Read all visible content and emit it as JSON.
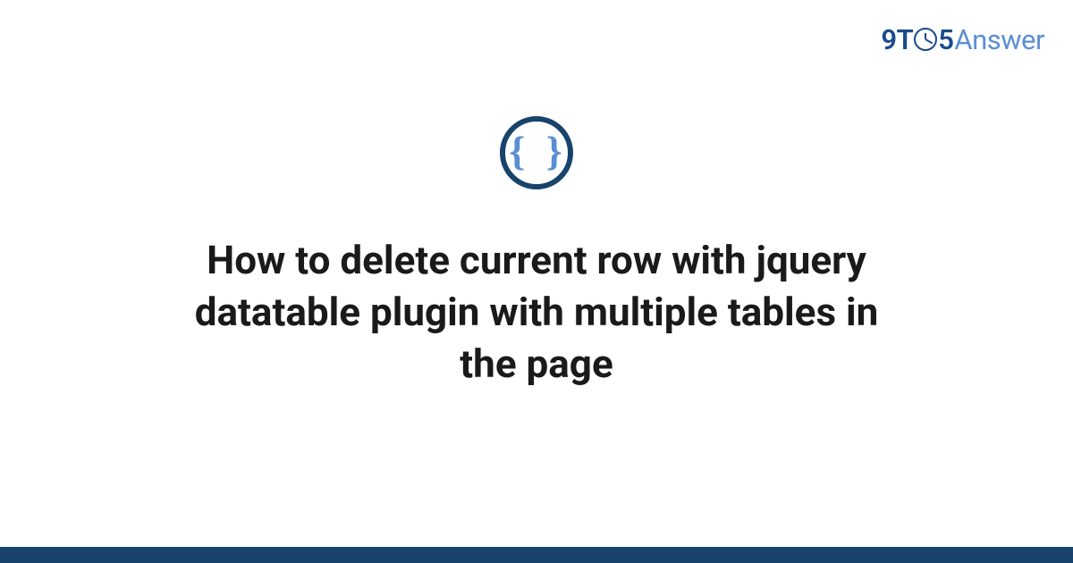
{
  "logo": {
    "part1": "9T",
    "part2": "5",
    "part3": "Answer"
  },
  "category_icon": {
    "symbol": "{ }",
    "name": "code-braces"
  },
  "title": "How to delete current row with jquery datatable plugin with multiple tables in the page",
  "colors": {
    "primary_dark": "#18436b",
    "primary_blue": "#1a4b8c",
    "accent_light": "#5a8fd4"
  }
}
